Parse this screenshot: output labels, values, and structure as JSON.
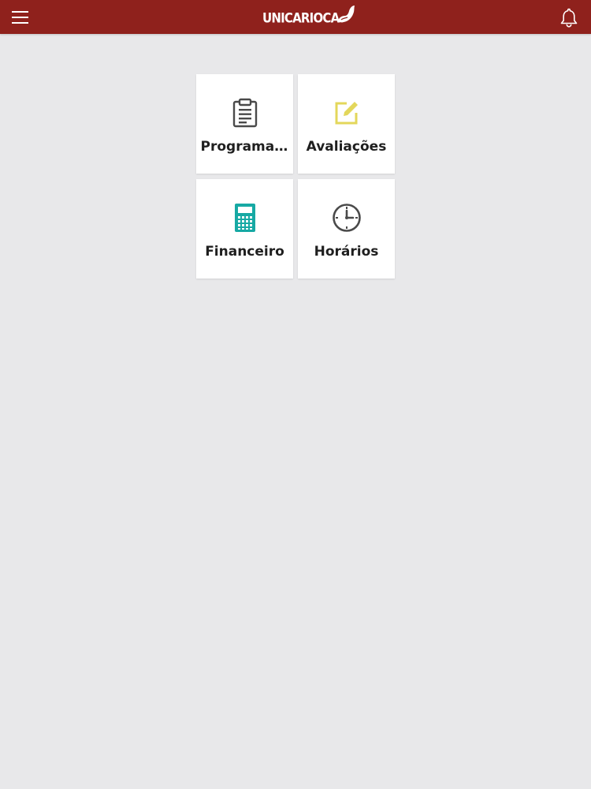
{
  "app_bar": {
    "logo_text": "UNICARIOCA",
    "background_color": "#8f211c",
    "menu_icon": "hamburger-menu-icon",
    "notification_icon": "bell-icon"
  },
  "menu": {
    "tiles": [
      {
        "label": "Programa...",
        "icon": "clipboard-icon",
        "icon_color": "#4a4a4a"
      },
      {
        "label": "Avaliações",
        "icon": "edit-icon",
        "icon_color": "#e3d75b"
      },
      {
        "label": "Financeiro",
        "icon": "calculator-icon",
        "icon_color": "#17a9a4"
      },
      {
        "label": "Horários",
        "icon": "clock-icon",
        "icon_color": "#4a4a4a"
      }
    ]
  }
}
